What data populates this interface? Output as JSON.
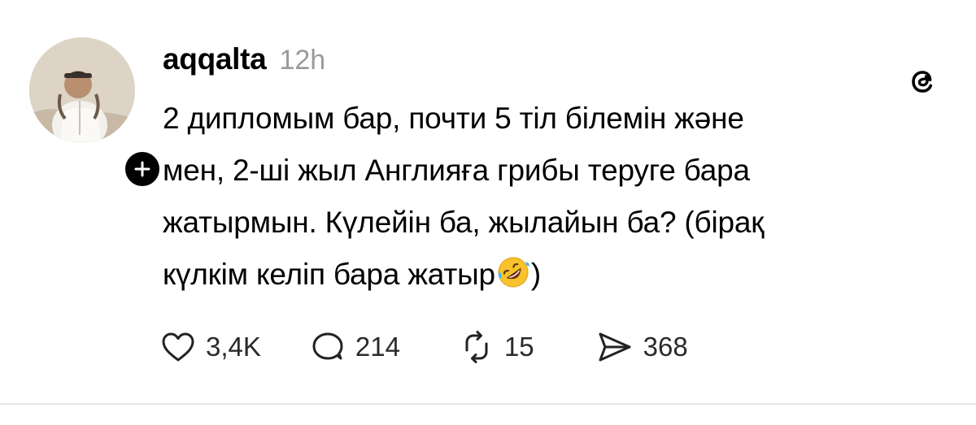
{
  "post": {
    "username": "aqqalta",
    "time": "12h",
    "body_lines": [
      "2 дипломым бар, почти 5 тіл білемін және",
      "мен, 2-ші жыл Англияға грибы теруге бара",
      "жатырмын. Күлейін ба, жылайын ба? (бірақ",
      "күлкім келіп бара жатыр"
    ],
    "body_tail": ")",
    "emoji": "rolling-on-floor-laughing-emoji"
  },
  "actions": {
    "likes": "3,4K",
    "replies": "214",
    "reposts": "15",
    "shares": "368"
  },
  "icons": {
    "follow": "plus-icon",
    "app": "threads-logo-icon",
    "like": "heart-icon",
    "reply": "comment-bubble-icon",
    "repost": "repost-icon",
    "share": "send-icon"
  },
  "colors": {
    "text": "#000000",
    "muted": "#9a9a9a",
    "count": "#2a2a2a",
    "divider": "#e8e8e8"
  }
}
